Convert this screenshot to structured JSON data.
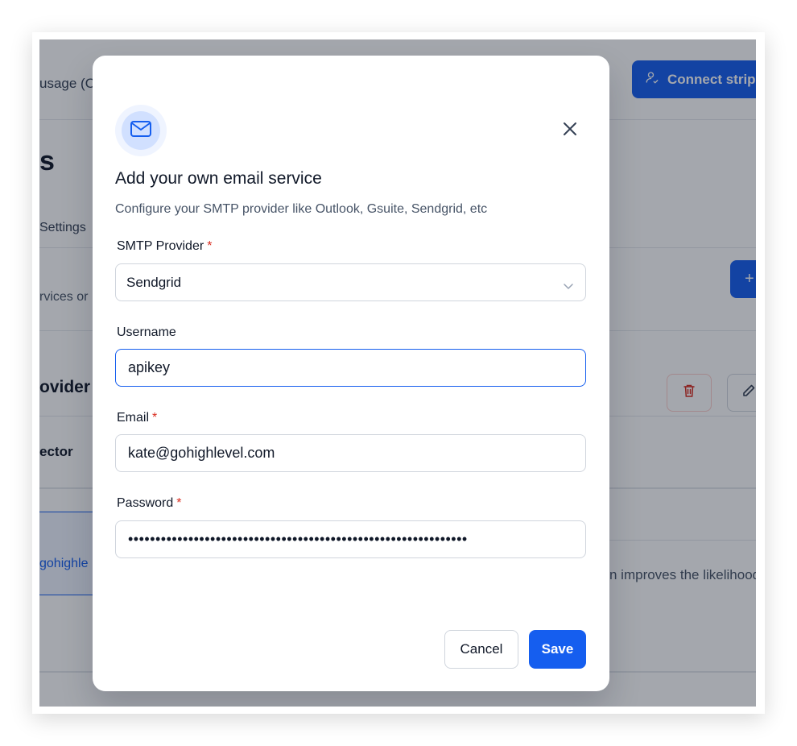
{
  "background": {
    "usage_text": "usage (O",
    "connect_button_label": "Connect stripe",
    "section_heading_fragment": "s",
    "settings_text": "Settings",
    "services_text": "rvices or",
    "plus_label": "+",
    "provider_heading_fragment": "ovider",
    "connector_fragment": "ector",
    "gohighlevel_fragment": "gohighle",
    "improves_text": "n improves the likelihood"
  },
  "modal": {
    "icon": "mail-icon",
    "title": "Add your own email service",
    "subtitle": "Configure your SMTP provider like Outlook, Gsuite, Sendgrid, etc",
    "smtp_provider": {
      "label": "SMTP Provider",
      "required_mark": "*",
      "value": "Sendgrid"
    },
    "username": {
      "label": "Username",
      "value": "apikey"
    },
    "email": {
      "label": "Email",
      "required_mark": "*",
      "value": "kate@gohighlevel.com"
    },
    "password": {
      "label": "Password",
      "required_mark": "*",
      "value": "••••••••••••••••••••••••••••••••••••••••••••••••••••••••••••••"
    },
    "cancel_label": "Cancel",
    "save_label": "Save"
  },
  "colors": {
    "primary": "#155eef",
    "required": "#d92d20",
    "overlay": "rgba(17,24,39,0.38)"
  }
}
